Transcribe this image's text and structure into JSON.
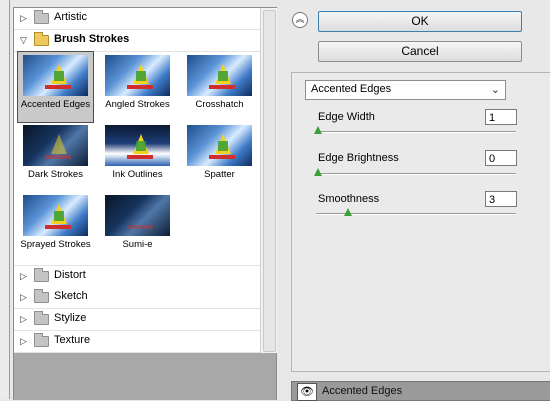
{
  "gallery": {
    "categories_top": [
      {
        "label": "Artistic",
        "open": false
      },
      {
        "label": "Brush Strokes",
        "open": true
      }
    ],
    "thumbnails": [
      {
        "caption": "Accented Edges",
        "selected": true
      },
      {
        "caption": "Angled Strokes",
        "selected": false
      },
      {
        "caption": "Crosshatch",
        "selected": false
      },
      {
        "caption": "Dark Strokes",
        "selected": false
      },
      {
        "caption": "Ink Outlines",
        "selected": false
      },
      {
        "caption": "Spatter",
        "selected": false
      },
      {
        "caption": "Sprayed Strokes",
        "selected": false
      },
      {
        "caption": "Sumi-e",
        "selected": false
      }
    ],
    "categories_bottom": [
      {
        "label": "Distort",
        "open": false
      },
      {
        "label": "Sketch",
        "open": false
      },
      {
        "label": "Stylize",
        "open": false
      },
      {
        "label": "Texture",
        "open": false
      }
    ]
  },
  "buttons": {
    "ok": "OK",
    "cancel": "Cancel",
    "collapse_icon": "double-chevron-up-icon"
  },
  "filter_select": {
    "value": "Accented Edges"
  },
  "parameters": [
    {
      "label": "Edge Width",
      "value": "1",
      "slider_fraction": 0.0
    },
    {
      "label": "Edge Brightness",
      "value": "0",
      "slider_fraction": 0.0
    },
    {
      "label": "Smoothness",
      "value": "3",
      "slider_fraction": 0.15
    }
  ],
  "layers": {
    "active": "Accented Edges",
    "visibility_icon": "eye-icon"
  }
}
